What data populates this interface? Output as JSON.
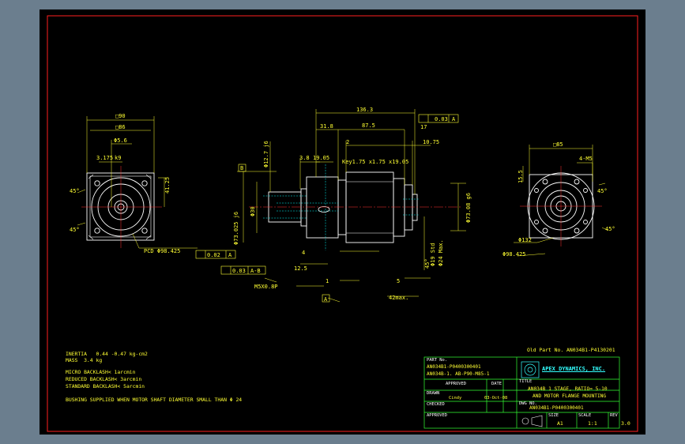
{
  "colors": {
    "background": "#000000",
    "frame": "#ff2020",
    "dimension": "#ffff33",
    "outline": "#ffffff",
    "center": "#ff3030",
    "hidden": "#00ffff",
    "title_block": "#33ff33"
  },
  "old_part": "Old Part No. AN034B1-P4130201",
  "notes": {
    "inertia": "INERTIA   0.44 -0.47 kg-cm2",
    "mass": "MASS  3.4 kg",
    "micro": "MICRO BACKLASH< 1arcmin",
    "reduced": "REDUCED BACKLASH< 3arcmin",
    "standard": "STANDARD BACKLASH< 5arcmin",
    "bushing": "BUSHING SUPPLIED WHEN MOTOR SHAFT DIAMETER SMALL THAN Φ 24"
  },
  "dims": {
    "d136": "136.3",
    "d87": "87.5",
    "d318": "31.8",
    "d2": "2",
    "d1075": "10.75",
    "d8": "3.8",
    "d1905": "19.05",
    "key": "Key1.75 x1.75 x19.05",
    "d003": "0.03",
    "datA": "A",
    "d17": "17",
    "sq90": "□90",
    "sq86": "□86",
    "d56": "Φ5.6",
    "d3175": "3.175",
    "k9": "k9",
    "d4125": "41.25",
    "d9": "45°",
    "d9b": "45°",
    "pcd": "PCD Φ98.425",
    "tol1": "0.02",
    "tolA": "A",
    "tol2": "0.03",
    "tolAB": "A-B",
    "m5": "M5X0.8P",
    "d4": "4",
    "d125": "12.5",
    "d1": "1",
    "d5": "5",
    "d42": "42max.",
    "s85": "□85",
    "r4m5": "4-M5",
    "d155": "15.5",
    "d132": "Φ132",
    "d98": "Φ98.425",
    "v1": "Φ73.025 j6",
    "v2": "Φ30",
    "v3": "Φ12.7 j6",
    "v4": "Φ19 Std",
    "v5": "Φ24 Max.",
    "v6": "Φ73.08 g6",
    "v7": "45°",
    "labB": "B",
    "labA": "A",
    "labA2": "A"
  },
  "title_block": {
    "part_no_label": "PART No.",
    "part_no_1": "AN034B1-P0400300401",
    "part_no_2": "AN034B-1. AB-P90-M85-1",
    "approved": "APPROVED",
    "date": "DATE",
    "drawn": "DRAWN",
    "drawn_by": "Cindy",
    "drawn_date": "03-Oct-08",
    "checked": "CHECKED",
    "approved2": "APPROVED",
    "title_label": "TITLE",
    "company": "APEX DYNAMICS, INC.",
    "title_1": "AN034B 1 STAGE, RATIO= 5-10",
    "title_2": "AND MOTOR FLANGE MOUNTING",
    "dwg_no_label": "DWG NO.",
    "dwg_no": "AN034B1-P0400300401",
    "size_label": "SIZE",
    "size": "A1",
    "scale_label": "SCALE",
    "scale": "1:1",
    "rev_label": "REV",
    "rev": "3.0"
  }
}
